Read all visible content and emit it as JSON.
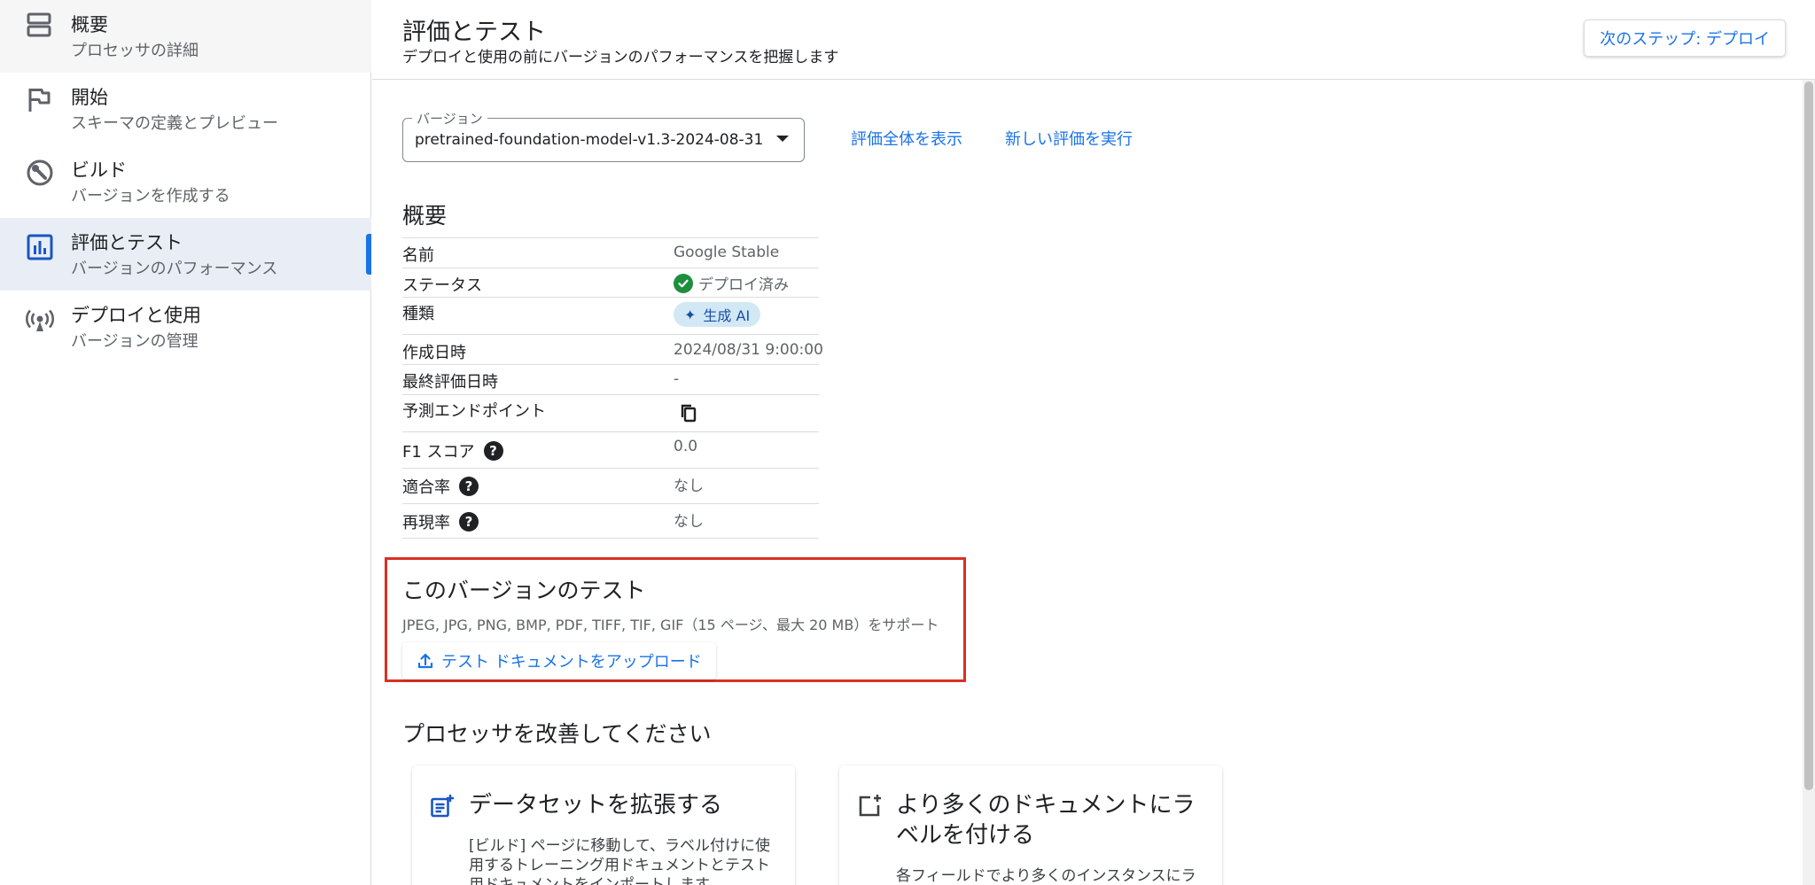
{
  "sidebar": {
    "items": [
      {
        "title": "概要",
        "subtitle": "プロセッサの詳細",
        "icon": "overview-icon"
      },
      {
        "title": "開始",
        "subtitle": "スキーマの定義とプレビュー",
        "icon": "flag-icon"
      },
      {
        "title": "ビルド",
        "subtitle": "バージョンを作成する",
        "icon": "build-icon"
      },
      {
        "title": "評価とテスト",
        "subtitle": "バージョンのパフォーマンス",
        "icon": "bar-chart-icon",
        "active": true
      },
      {
        "title": "デプロイと使用",
        "subtitle": "バージョンの管理",
        "icon": "broadcast-icon"
      }
    ]
  },
  "header": {
    "title": "評価とテスト",
    "subtitle": "デプロイと使用の前にバージョンのパフォーマンスを把握します",
    "next_button": "次のステップ: デプロイ"
  },
  "version": {
    "label": "バージョン",
    "value": "pretrained-foundation-model-v1.3-2024-08-31"
  },
  "links": {
    "view_all": "評価全体を表示",
    "run_new": "新しい評価を実行"
  },
  "overview": {
    "title": "概要",
    "rows": [
      {
        "key": "名前",
        "value": "Google Stable"
      },
      {
        "key": "ステータス",
        "value": "デプロイ済み"
      },
      {
        "key": "種類",
        "value": "生成 AI"
      },
      {
        "key": "作成日時",
        "value": "2024/08/31 9:00:00"
      },
      {
        "key": "最終評価日時",
        "value": "-"
      },
      {
        "key": "予測エンドポイント",
        "value": ""
      },
      {
        "key": "F1 スコア",
        "value": "0.0"
      },
      {
        "key": "適合率",
        "value": "なし"
      },
      {
        "key": "再現率",
        "value": "なし"
      }
    ]
  },
  "test": {
    "title": "このバージョンのテスト",
    "formats": "JPEG, JPG, PNG, BMP, PDF, TIFF, TIF, GIF（15 ページ、最大 20 MB）をサポート",
    "upload_button": "テスト ドキュメントをアップロード"
  },
  "improve": {
    "title": "プロセッサを改善してください",
    "cards": [
      {
        "title": "データセットを拡張する",
        "body": "[ビルド] ページに移動して、ラベル付けに使用するトレーニング用ドキュメントとテスト用ドキュメントをインポートします"
      },
      {
        "title": "より多くのドキュメントにラベルを付ける",
        "body": "各フィールドでより多くのインスタンスにラ"
      }
    ]
  },
  "colors": {
    "accent": "#1a73e8",
    "highlight_border": "#d93025",
    "active_nav_bg": "#e9eef6",
    "success": "#1e8e3e",
    "chip_bg": "#d3e8f5"
  }
}
